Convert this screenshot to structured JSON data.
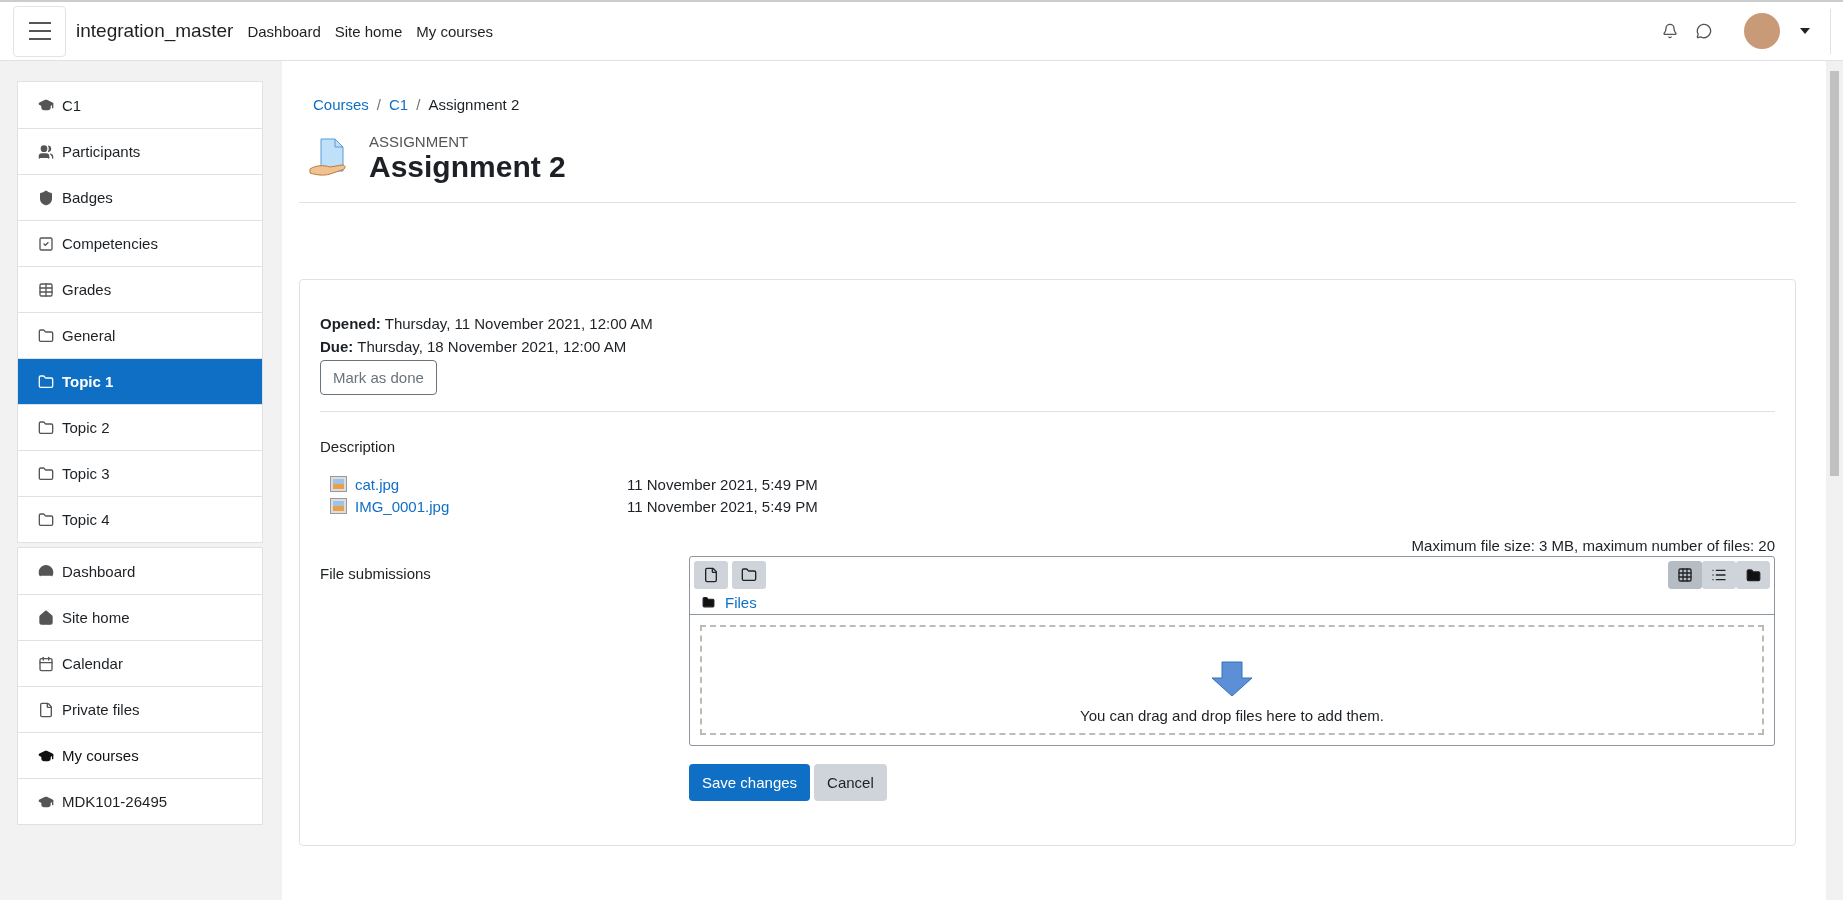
{
  "navbar": {
    "site_name": "integration_master",
    "links": [
      "Dashboard",
      "Site home",
      "My courses"
    ]
  },
  "sidebar": {
    "groups": [
      [
        {
          "label": "C1",
          "kind": "course",
          "selected": false,
          "bold": false
        },
        {
          "label": "Participants",
          "kind": "participants",
          "selected": false,
          "bold": false
        },
        {
          "label": "Badges",
          "kind": "badges",
          "selected": false,
          "bold": false
        },
        {
          "label": "Competencies",
          "kind": "competencies",
          "selected": false,
          "bold": false
        },
        {
          "label": "Grades",
          "kind": "grades",
          "selected": false,
          "bold": false
        },
        {
          "label": "General",
          "kind": "section",
          "selected": false,
          "bold": false
        },
        {
          "label": "Topic 1",
          "kind": "section",
          "selected": true,
          "bold": false
        },
        {
          "label": "Topic 2",
          "kind": "section",
          "selected": false,
          "bold": false
        },
        {
          "label": "Topic 3",
          "kind": "section",
          "selected": false,
          "bold": false
        },
        {
          "label": "Topic 4",
          "kind": "section",
          "selected": false,
          "bold": false
        }
      ],
      [
        {
          "label": "Dashboard",
          "kind": "dashboard",
          "selected": false,
          "bold": false
        },
        {
          "label": "Site home",
          "kind": "home",
          "selected": false,
          "bold": false
        },
        {
          "label": "Calendar",
          "kind": "calendar",
          "selected": false,
          "bold": false
        },
        {
          "label": "Private files",
          "kind": "files",
          "selected": false,
          "bold": false
        },
        {
          "label": "My courses",
          "kind": "course",
          "selected": false,
          "bold": true
        },
        {
          "label": "MDK101-26495",
          "kind": "course",
          "selected": false,
          "bold": false
        }
      ]
    ]
  },
  "breadcrumb": [
    {
      "label": "Courses",
      "kind": "link"
    },
    {
      "label": "/",
      "kind": "separator"
    },
    {
      "label": "C1",
      "kind": "link"
    },
    {
      "label": "/",
      "kind": "separator"
    },
    {
      "label": "Assignment 2",
      "kind": "current"
    }
  ],
  "page_header": {
    "kind_label": "ASSIGNMENT",
    "title": "Assignment 2"
  },
  "dates": [
    "**Opened:** Thursday, 11 November 2021, 12:00 AM",
    "**Due:** Thursday, 18 November 2021, 12:00 AM"
  ],
  "mark_button": "Mark as done",
  "description": {
    "label": "Description",
    "files": [
      {
        "name": "cat.jpg",
        "date": "11 November 2021, 5:49 PM"
      },
      {
        "name": "IMG_0001.jpg",
        "date": "11 November 2021, 5:49 PM"
      }
    ]
  },
  "file_submissions": {
    "label": "File submissions",
    "limits": "Maximum file size: 3 MB, maximum number of files: 20",
    "path": "Files",
    "views": [
      {
        "kind": "grid",
        "selected": true
      },
      {
        "kind": "list",
        "selected": false
      },
      {
        "kind": "tree",
        "selected": false
      }
    ],
    "drop_hint": "You can drag and drop files here to add them."
  },
  "buttons": [
    {
      "label": "Save changes",
      "primary": true
    },
    {
      "label": "Cancel",
      "primary": false
    }
  ]
}
